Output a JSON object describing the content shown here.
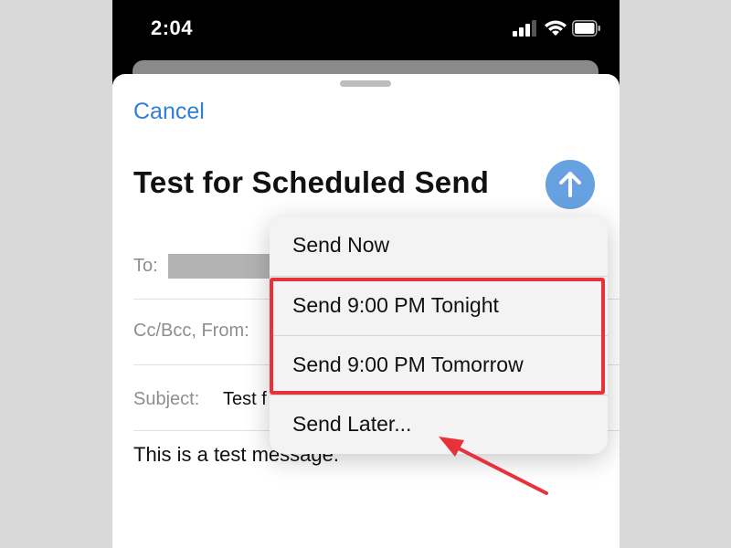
{
  "status_bar": {
    "time": "2:04",
    "icons": [
      "signal-icon",
      "wifi-icon",
      "battery-icon"
    ]
  },
  "compose": {
    "cancel_label": "Cancel",
    "title": "Test for Scheduled Send",
    "send_icon": "arrow-up-icon",
    "fields": {
      "to_label": "To:",
      "cc_label": "Cc/Bcc, From:",
      "subject_label": "Subject:",
      "subject_value": "Test f"
    },
    "body": "This is a test message."
  },
  "send_menu": {
    "items": [
      {
        "label": "Send Now"
      },
      {
        "label": "Send 9:00 PM Tonight"
      },
      {
        "label": "Send 9:00 PM Tomorrow"
      },
      {
        "label": "Send Later..."
      }
    ]
  },
  "colors": {
    "accent": "#2f7ed8",
    "highlight": "#e8323a"
  }
}
